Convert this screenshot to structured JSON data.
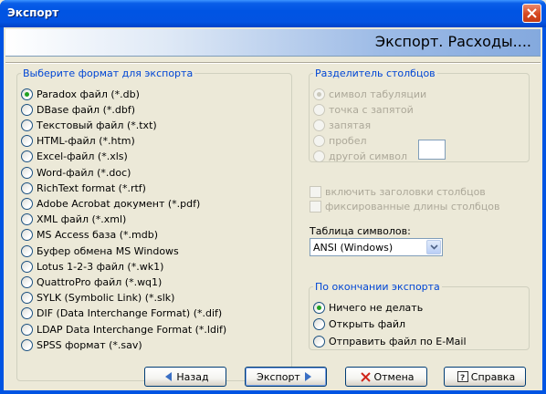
{
  "window": {
    "title": "Экспорт"
  },
  "header": {
    "title": "Экспорт. Расходы...."
  },
  "formats": {
    "legend": "Выберите формат для экспорта",
    "selected_index": 0,
    "items": [
      "Paradox файл (*.db)",
      "DBase файл (*.dbf)",
      "Текстовый файл (*.txt)",
      "HTML-файл (*.htm)",
      "Excel-файл (*.xls)",
      "Word-файл (*.doc)",
      "RichText format (*.rtf)",
      "Adobe Acrobat документ (*.pdf)",
      "XML файл (*.xml)",
      "MS Access база (*.mdb)",
      "Буфер обмена MS Windows",
      "Lotus 1-2-3 файл (*.wk1)",
      "QuattroPro файл (*.wq1)",
      "SYLK (Symbolic Link) (*.slk)",
      "DIF (Data Interchange Format) (*.dif)",
      "LDAP Data Interchange Format (*.ldif)",
      "SPSS формат (*.sav)"
    ]
  },
  "separator": {
    "legend": "Разделитель столбцов",
    "items": [
      "символ табуляции",
      "точка с запятой",
      "запятая",
      "пробел",
      "другой символ"
    ],
    "selected_index": 0,
    "disabled": true,
    "other_value": ""
  },
  "checkboxes": {
    "include_headers": "включить заголовки столбцов",
    "fixed_width": "фиксированные длины столбцов"
  },
  "charset": {
    "label": "Таблица символов:",
    "value": "ANSI (Windows)"
  },
  "after_export": {
    "legend": "По окончании экспорта",
    "items": [
      "Ничего не делать",
      "Открыть файл",
      "Отправить файл по E-Mail"
    ],
    "selected_index": 0
  },
  "buttons": {
    "back": "Назад",
    "export": "Экспорт",
    "cancel": "Отмена",
    "help": "Справка"
  },
  "colors": {
    "titlebar": "#0054e3",
    "group_legend": "#0046d5",
    "disabled_text": "#aca899"
  }
}
